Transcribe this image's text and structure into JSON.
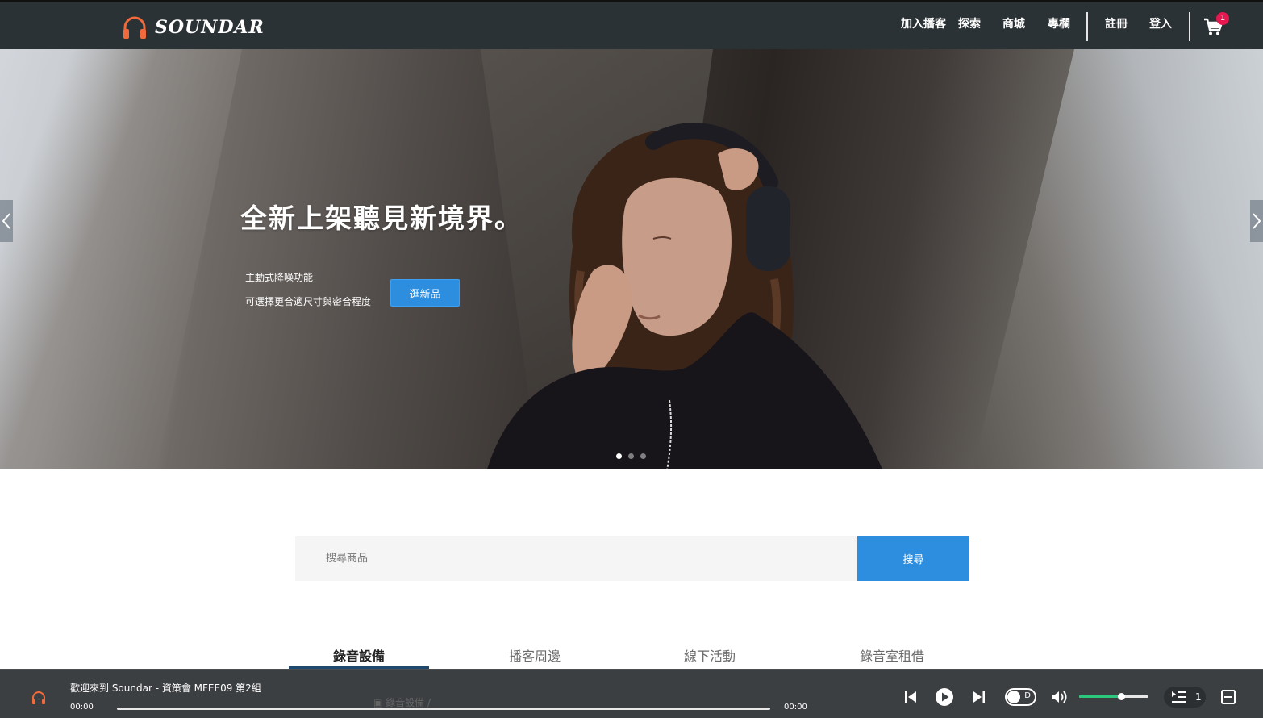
{
  "brand": {
    "name": "SOUNDAR",
    "accent": "#f06a3c"
  },
  "nav": {
    "items": [
      "加入播客",
      "探索",
      "商城",
      "專欄"
    ],
    "auth": [
      "註冊",
      "登入"
    ],
    "cart_count": "1"
  },
  "hero": {
    "title": "全新上架聽見新境界。",
    "line1": "主動式降噪功能",
    "line2": "可選擇更合適尺寸與密合程度",
    "cta": "逛新品",
    "slides": 3,
    "active_slide": 1
  },
  "search": {
    "placeholder": "搜尋商品",
    "button": "搜尋"
  },
  "tabs": [
    "錄音設備",
    "播客周邊",
    "線下活動",
    "錄音室租借"
  ],
  "active_tab": "錄音設備",
  "breadcrumb": "錄音設備 /",
  "player": {
    "title": "歡迎來到 Soundar - 資策會 MFEE09 第2組",
    "current_time": "00:00",
    "total_time": "00:00",
    "toggle_label": "D",
    "queue_count": "1",
    "volume_level": 0.6,
    "accent": "#2bc77a"
  }
}
